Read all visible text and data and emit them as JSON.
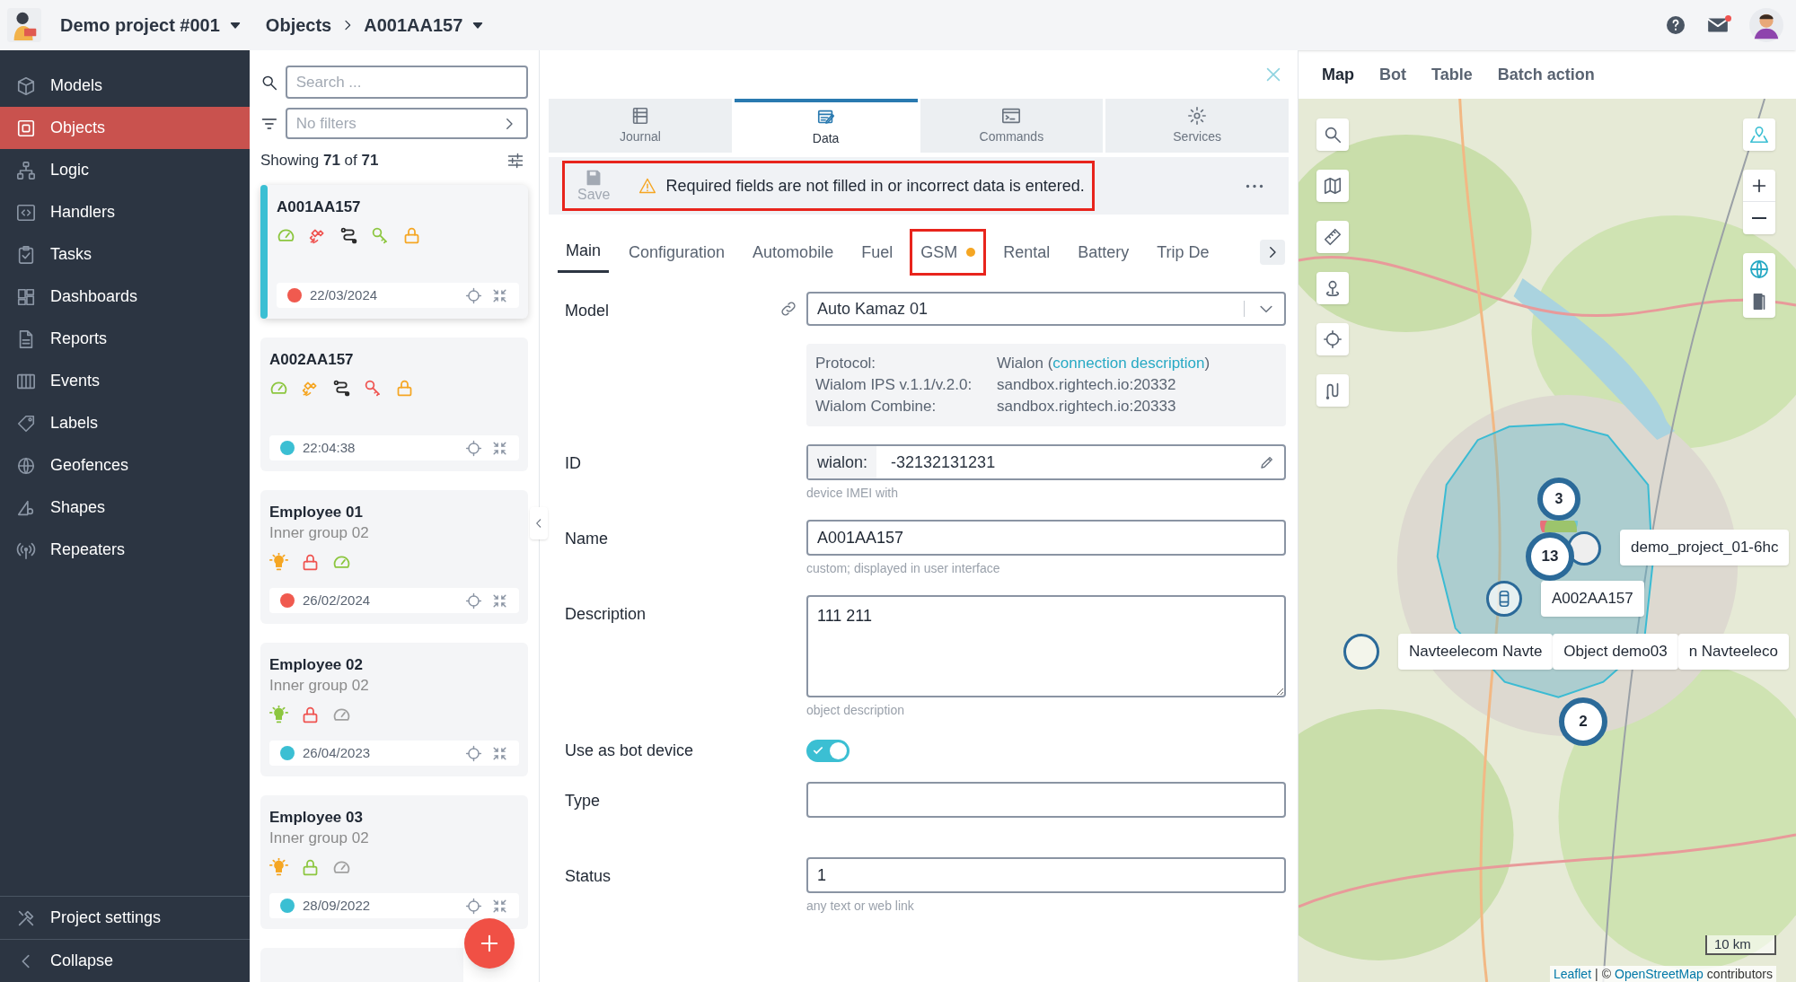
{
  "header": {
    "project": "Demo project #001",
    "breadcrumb": [
      "Objects",
      "A001AA157"
    ],
    "has_notification": true
  },
  "sidebar": {
    "items": [
      {
        "label": "Models",
        "selected": false
      },
      {
        "label": "Objects",
        "selected": true
      },
      {
        "label": "Logic",
        "selected": false
      },
      {
        "label": "Handlers",
        "selected": false
      },
      {
        "label": "Tasks",
        "selected": false
      },
      {
        "label": "Dashboards",
        "selected": false
      },
      {
        "label": "Reports",
        "selected": false
      },
      {
        "label": "Events",
        "selected": false
      },
      {
        "label": "Labels",
        "selected": false
      },
      {
        "label": "Geofences",
        "selected": false
      },
      {
        "label": "Shapes",
        "selected": false
      },
      {
        "label": "Repeaters",
        "selected": false
      }
    ],
    "footer": [
      "Project settings",
      "Collapse"
    ]
  },
  "object_list": {
    "search_placeholder": "Search ...",
    "filter_placeholder": "No filters",
    "count": "Showing **71** of **71**",
    "cards": [
      {
        "title": "A001AA157",
        "selected": true,
        "icons": [
          {
            "kind": "speed",
            "color": "#8cc63f"
          },
          {
            "kind": "satellite",
            "color": "#ef5350"
          },
          {
            "kind": "route",
            "color": "#2b2b2b"
          },
          {
            "kind": "key",
            "color": "#8cc63f"
          },
          {
            "kind": "lock",
            "color": "#f5a623"
          }
        ],
        "color": "#f05a4f",
        "date": "22/03/2024"
      },
      {
        "title": "A002AA157",
        "selected": false,
        "icons": [
          {
            "kind": "speed",
            "color": "#8cc63f"
          },
          {
            "kind": "satellite",
            "color": "#f5a623"
          },
          {
            "kind": "route",
            "color": "#2b2b2b"
          },
          {
            "kind": "key",
            "color": "#ef5350"
          },
          {
            "kind": "lock",
            "color": "#f5a623"
          }
        ],
        "color": "#3bbfd3",
        "date": "22:04:38"
      },
      {
        "title": "Employee 01",
        "subtitle": "Inner group 02",
        "selected": false,
        "icons": [
          {
            "kind": "bulb",
            "color": "#f5a623"
          },
          {
            "kind": "lock",
            "color": "#ef5350"
          },
          {
            "kind": "speed",
            "color": "#8cc63f"
          }
        ],
        "color": "#f05a4f",
        "date": "26/02/2024"
      },
      {
        "title": "Employee 02",
        "subtitle": "Inner group 02",
        "selected": false,
        "icons": [
          {
            "kind": "bulb",
            "color": "#8cc63f"
          },
          {
            "kind": "lock",
            "color": "#ef5350"
          },
          {
            "kind": "speed",
            "color": "#a0a0a0"
          }
        ],
        "color": "#3bbfd3",
        "date": "26/04/2023"
      },
      {
        "title": "Employee 03",
        "subtitle": "Inner group 02",
        "selected": false,
        "icons": [
          {
            "kind": "bulb",
            "color": "#f5a623"
          },
          {
            "kind": "lock",
            "color": "#8cc63f"
          },
          {
            "kind": "speed",
            "color": "#a0a0a0"
          }
        ],
        "color": "#3bbfd3",
        "date": "28/09/2022"
      }
    ]
  },
  "detail": {
    "tabs": [
      {
        "label": "Journal",
        "selected": false
      },
      {
        "label": "Data",
        "selected": true
      },
      {
        "label": "Commands",
        "selected": false
      },
      {
        "label": "Services",
        "selected": false
      }
    ],
    "save_bar": {
      "save": "Save",
      "save_disabled": true,
      "warning": "Required fields are not filled in or incorrect data is entered.",
      "highlighted": true
    },
    "subtabs": [
      {
        "label": "Main",
        "selected": true,
        "dot": false,
        "highlighted": false
      },
      {
        "label": "Configuration",
        "selected": false,
        "dot": false,
        "highlighted": false
      },
      {
        "label": "Automobile",
        "selected": false,
        "dot": false,
        "highlighted": false
      },
      {
        "label": "Fuel",
        "selected": false,
        "dot": false,
        "highlighted": false
      },
      {
        "label": "GSM",
        "selected": false,
        "dot": true,
        "highlighted": true
      },
      {
        "label": "Rental",
        "selected": false,
        "dot": false,
        "highlighted": false
      },
      {
        "label": "Battery",
        "selected": false,
        "dot": false,
        "highlighted": false
      },
      {
        "label": "Trip De",
        "selected": false,
        "dot": false,
        "highlighted": false
      }
    ],
    "fields": [
      {
        "kind": "select",
        "label": "Model",
        "value": "Auto Kamaz 01"
      },
      {
        "kind": "info",
        "rows": [
          {
            "label": "Protocol:",
            "value": "Wialon (",
            "link": "connection description",
            "value_end": ")"
          },
          {
            "label": "Wialom IPS v.1.1/v.2.0:",
            "value": "sandbox.rightech.io:20332"
          },
          {
            "label": "Wialom Combine:",
            "value": "sandbox.rightech.io:20333"
          }
        ]
      },
      {
        "kind": "prefixed",
        "label": "ID",
        "prefix": "wialon:",
        "value": "-32132131231",
        "hint": "device IMEI with"
      },
      {
        "kind": "input",
        "label": "Name",
        "value": "A001AA157",
        "hint": "custom; displayed in user interface"
      },
      {
        "kind": "textarea",
        "label": "Description",
        "value": "111 211",
        "hint": "object description"
      },
      {
        "kind": "toggle",
        "label": "Use as bot device",
        "on": true
      },
      {
        "kind": "input",
        "label": "Type"
      },
      {
        "kind": "input",
        "label": "Status",
        "value": "1",
        "hint": "any text or web link"
      }
    ]
  },
  "map_panel": {
    "tabs": [
      {
        "label": "Map",
        "selected": true
      },
      {
        "label": "Bot",
        "selected": false
      },
      {
        "label": "Table",
        "selected": false
      },
      {
        "label": "Batch action",
        "selected": false
      }
    ],
    "clusters": [
      {
        "count": "3"
      },
      {
        "count": "13"
      },
      {
        "count": "2"
      }
    ],
    "labels": [
      "demo_project_01-6hc",
      "A002AA157",
      "Navteelecom Navte",
      "Object demo03",
      "n Navteeleco"
    ],
    "scale": "10 km",
    "attribution": {
      "link": "Leaflet",
      "separator": "|",
      "copyright": "©",
      "source": "OpenStreetMap",
      "rest": "contributors"
    }
  }
}
